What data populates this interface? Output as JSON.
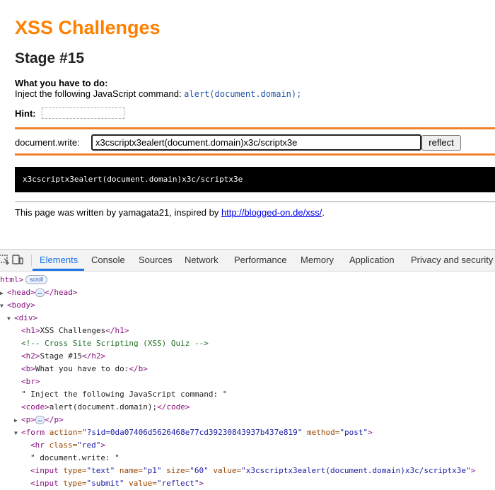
{
  "page": {
    "h1": "XSS Challenges",
    "h2": "Stage #15",
    "todo_title": "What you have to do:",
    "todo_text": "Inject the following JavaScript command: ",
    "todo_code": "alert(document.domain);",
    "hint_label": "Hint:",
    "form_label": "document.write:",
    "input_value": "x3cscriptx3ealert(document.domain)x3c/scriptx3e",
    "submit_label": "reflect",
    "output": "x3cscriptx3ealert(document.domain)x3c/scriptx3e",
    "footer_text": "This page was written by yamagata21, inspired by ",
    "footer_link": "http://blogged-on.de/xss/",
    "footer_end": ".",
    "colors": {
      "title": "#ff8000",
      "rule": "#f08030",
      "output_bg": "#000000"
    }
  },
  "devtools": {
    "tabs": [
      {
        "label": "Elements",
        "active": true
      },
      {
        "label": "Console"
      },
      {
        "label": "Sources"
      },
      {
        "label": "Network"
      },
      {
        "label": "Performance"
      },
      {
        "label": "Memory"
      },
      {
        "label": "Application"
      },
      {
        "label": "Privacy and security"
      }
    ],
    "tree": {
      "html_open": "html>",
      "scroll_badge": "scroll",
      "head_open": "<head>",
      "head_dots": "…",
      "head_close": "</head>",
      "body_open": "<body>",
      "div_open": "<div>",
      "h1_open": "<h1>",
      "h1_text": "XSS Challenges",
      "h1_close": "</h1>",
      "comment": "<!-- Cross Site Scripting (XSS) Quiz -->",
      "h2_open": "<h2>",
      "h2_text": "Stage #15",
      "h2_close": "</h2>",
      "b_open": "<b>",
      "b_text": "What you have to do:",
      "b_close": "</b>",
      "br": "<br>",
      "text_node": "\" Inject the following JavaScript command: \"",
      "code_open": "<code>",
      "code_text": "alert(document.domain);",
      "code_close": "</code>",
      "p_open": "<p>",
      "p_dots": "…",
      "p_close": "</p>",
      "form_open": "<form",
      "form_action_attr": "action=",
      "form_action_val": "\"?sid=0da07406d5626468e77cd39230843937b437e819\"",
      "form_method_attr": "method=",
      "form_method_val": "\"post\"",
      "form_end": ">",
      "hr_open": "<hr",
      "hr_class_attr": "class=",
      "hr_class_val": "\"red\"",
      "hr_end": ">",
      "text_node2": "\" document.write: \"",
      "input1_open": "<input",
      "input1_type_attr": "type=",
      "input1_type_val": "\"text\"",
      "input1_name_attr": "name=",
      "input1_name_val": "\"p1\"",
      "input1_size_attr": "size=",
      "input1_size_val": "\"60\"",
      "input1_value_attr": "value=",
      "input1_value_val": "\"x3cscriptx3ealert(document.domain)x3c/scriptx3e\"",
      "input1_end": ">",
      "input2_open": "<input",
      "input2_type_attr": "type=",
      "input2_type_val": "\"submit\"",
      "input2_value_attr": "value=",
      "input2_value_val": "\"reflect\"",
      "input2_end": ">"
    }
  }
}
